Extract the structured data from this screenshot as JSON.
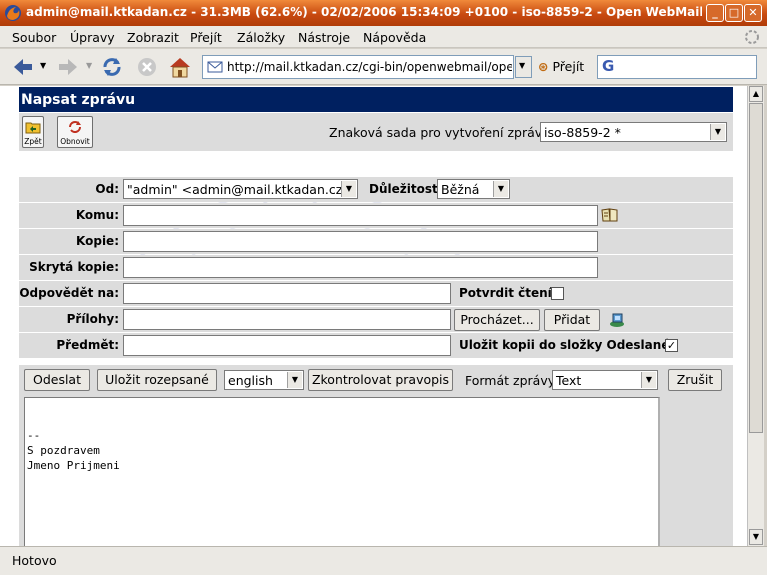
{
  "window": {
    "title": "admin@mail.ktkadan.cz - 31.3MB (62.6%) - 02/02/2006 15:34:09 +0100 - iso-8859-2 - Open WebMail (z) - Firefox"
  },
  "menubar": {
    "items": [
      "Soubor",
      "Úpravy",
      "Zobrazit",
      "Přejít",
      "Záložky",
      "Nástroje",
      "Nápověda"
    ]
  },
  "navbar": {
    "url": "http://mail.ktkadan.cz/cgi-bin/openwebmail/openwebmail-send.pl",
    "go_label": "Přejít"
  },
  "compose": {
    "header_title": "Napsat zprávu",
    "back_label": "Zpět",
    "refresh_label": "Obnovit",
    "charset_label": "Znaková sada pro vytvoření zprávy:",
    "charset_value": "iso-8859-2 *",
    "from_label": "Od:",
    "from_value": "\"admin\" <admin@mail.ktkadan.cz>",
    "priority_label": "Důležitost:",
    "priority_value": "Běžná",
    "to_label": "Komu:",
    "cc_label": "Kopie:",
    "bcc_label": "Skrytá kopie:",
    "replyto_label": "Odpovědět na:",
    "confirm_read_label": "Potvrdit čtení:",
    "confirm_read_checked": false,
    "attachments_label": "Přílohy:",
    "browse_label": "Procházet...",
    "add_label": "Přidat",
    "subject_label": "Předmět:",
    "save_copy_label": "Uložit kopii do složky Odeslané:",
    "save_copy_checked": true,
    "send_label": "Odeslat",
    "save_draft_label": "Uložit rozepsané",
    "spell_lang_value": "english",
    "spellcheck_label": "Zkontrolovat pravopis",
    "format_label": "Formát zprávy",
    "format_value": "Text",
    "cancel_label": "Zrušit",
    "body_lines": [
      "--",
      "S pozdravem",
      "Jmeno Prijmeni"
    ]
  },
  "status": {
    "text": "Hotovo"
  },
  "colors": {
    "header_blue": "#002060",
    "title_orange": "#c84a10"
  }
}
